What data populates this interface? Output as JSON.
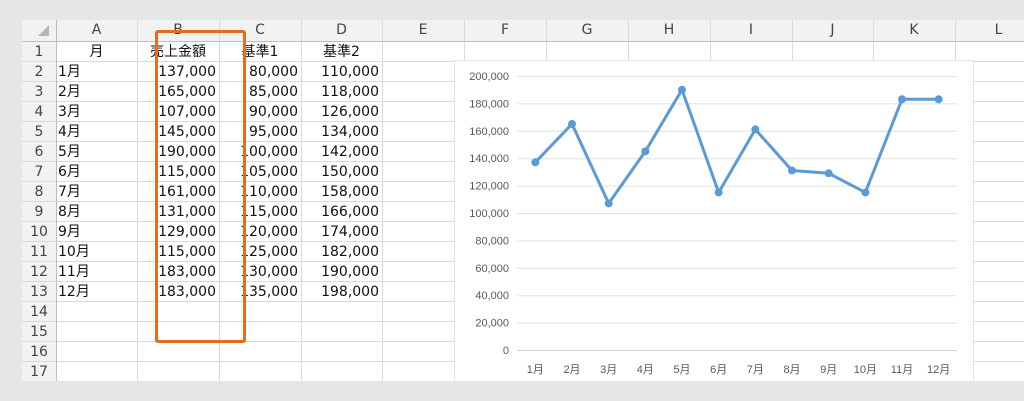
{
  "spreadsheet": {
    "columns": [
      "A",
      "B",
      "C",
      "D",
      "E",
      "F",
      "G",
      "H",
      "I",
      "J",
      "K",
      "L"
    ],
    "rows": [
      "1",
      "2",
      "3",
      "4",
      "5",
      "6",
      "7",
      "8",
      "9",
      "10",
      "11",
      "12",
      "13",
      "14",
      "15",
      "16",
      "17"
    ],
    "headers": [
      "月",
      "売上金額",
      "基準1",
      "基準2"
    ],
    "data": [
      [
        "1月",
        "137,000",
        "80,000",
        "110,000"
      ],
      [
        "2月",
        "165,000",
        "85,000",
        "118,000"
      ],
      [
        "3月",
        "107,000",
        "90,000",
        "126,000"
      ],
      [
        "4月",
        "145,000",
        "95,000",
        "134,000"
      ],
      [
        "5月",
        "190,000",
        "100,000",
        "142,000"
      ],
      [
        "6月",
        "115,000",
        "105,000",
        "150,000"
      ],
      [
        "7月",
        "161,000",
        "110,000",
        "158,000"
      ],
      [
        "8月",
        "131,000",
        "115,000",
        "166,000"
      ],
      [
        "9月",
        "129,000",
        "120,000",
        "174,000"
      ],
      [
        "10月",
        "115,000",
        "125,000",
        "182,000"
      ],
      [
        "11月",
        "183,000",
        "130,000",
        "190,000"
      ],
      [
        "12月",
        "183,000",
        "135,000",
        "198,000"
      ]
    ],
    "highlight_color": "#e46c1c",
    "highlighted_column": "B"
  },
  "chart_data": {
    "type": "line",
    "categories": [
      "1月",
      "2月",
      "3月",
      "4月",
      "5月",
      "6月",
      "7月",
      "8月",
      "9月",
      "10月",
      "11月",
      "12月"
    ],
    "series": [
      {
        "values": [
          137000,
          165000,
          107000,
          145000,
          190000,
          115000,
          161000,
          131000,
          129000,
          115000,
          183000,
          183000
        ]
      }
    ],
    "yticks": [
      "0",
      "20,000",
      "40,000",
      "60,000",
      "80,000",
      "100,000",
      "120,000",
      "140,000",
      "160,000",
      "180,000",
      "200,000"
    ],
    "ylim": [
      0,
      200000
    ],
    "grid": true,
    "legend": "none",
    "line_color": "#5b9bd5"
  }
}
